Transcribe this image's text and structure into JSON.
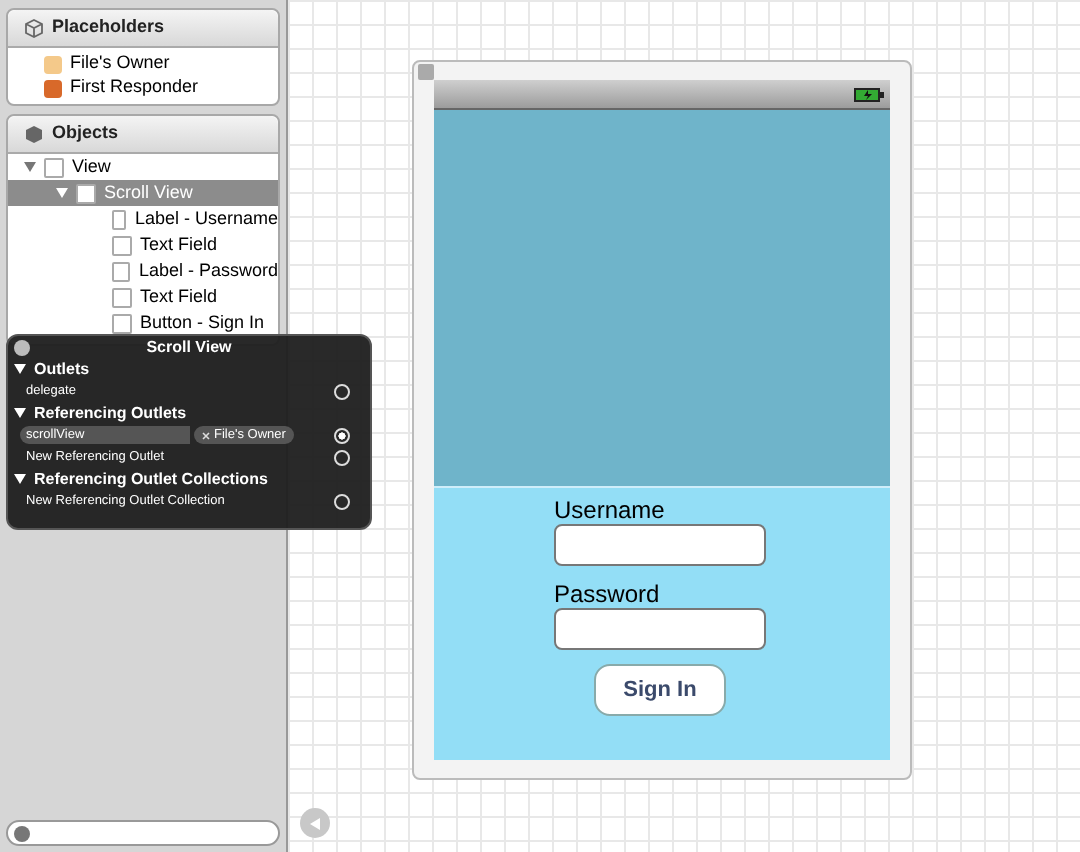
{
  "placeholders": {
    "title": "Placeholders",
    "items": [
      {
        "label": "File's Owner",
        "kind": "owner"
      },
      {
        "label": "First Responder",
        "kind": "responder"
      }
    ]
  },
  "objects": {
    "title": "Objects",
    "tree": [
      {
        "label": "View",
        "expanded": true,
        "selected": false,
        "children": [
          {
            "label": "Scroll View",
            "expanded": true,
            "selected": true,
            "children": [
              {
                "label": "Label - Username",
                "selected": false
              },
              {
                "label": "Text Field",
                "selected": false
              },
              {
                "label": "Label - Password",
                "selected": false
              },
              {
                "label": "Text Field",
                "selected": false
              },
              {
                "label": "Button - Sign In",
                "selected": false
              }
            ]
          }
        ]
      }
    ]
  },
  "inspector": {
    "title": "Scroll View",
    "sections": [
      {
        "title": "Outlets",
        "expanded": true,
        "rows": [
          {
            "label": "delegate",
            "connected": false
          }
        ]
      },
      {
        "title": "Referencing Outlets",
        "expanded": true,
        "rows": [
          {
            "label": "scrollView",
            "connected": true,
            "target": "File's Owner"
          },
          {
            "label": "New Referencing Outlet",
            "connected": false
          }
        ]
      },
      {
        "title": "Referencing Outlet Collections",
        "expanded": true,
        "rows": [
          {
            "label": "New Referencing Outlet Collection",
            "connected": false
          }
        ]
      }
    ]
  },
  "form": {
    "username_label": "Username",
    "password_label": "Password",
    "button": "Sign In"
  }
}
